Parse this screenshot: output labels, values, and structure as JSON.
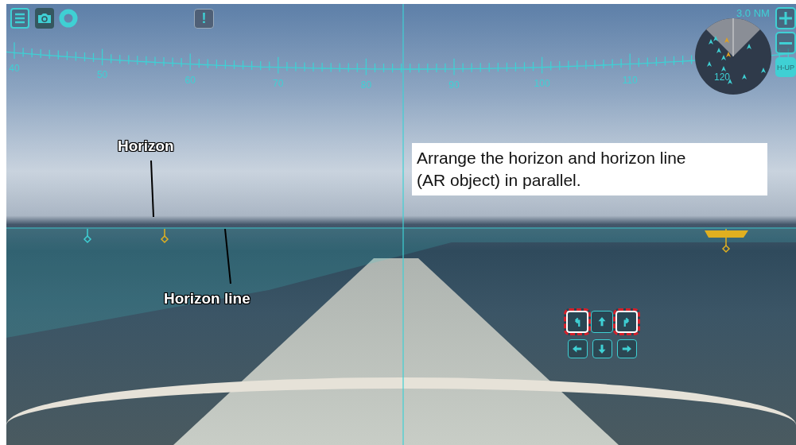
{
  "toolbar": {
    "alert": "!"
  },
  "heading_scale": {
    "labels": [
      "40",
      "50",
      "60",
      "70",
      "80",
      "90",
      "100",
      "110"
    ]
  },
  "radar": {
    "range": "3.0 NM",
    "heading": "120",
    "mode": "H-UP"
  },
  "callouts": [
    {
      "text": "Horizon"
    },
    {
      "text": "Horizon line"
    }
  ],
  "note": "Arrange the horizon and horizon line (AR object) in parallel.",
  "pad": {
    "buttons": [
      {
        "kind": "rotate-left",
        "highlighted": true
      },
      {
        "kind": "up",
        "highlighted": false
      },
      {
        "kind": "rotate-right",
        "highlighted": true
      },
      {
        "kind": "left",
        "highlighted": false
      },
      {
        "kind": "down",
        "highlighted": false
      },
      {
        "kind": "right",
        "highlighted": false
      }
    ]
  }
}
